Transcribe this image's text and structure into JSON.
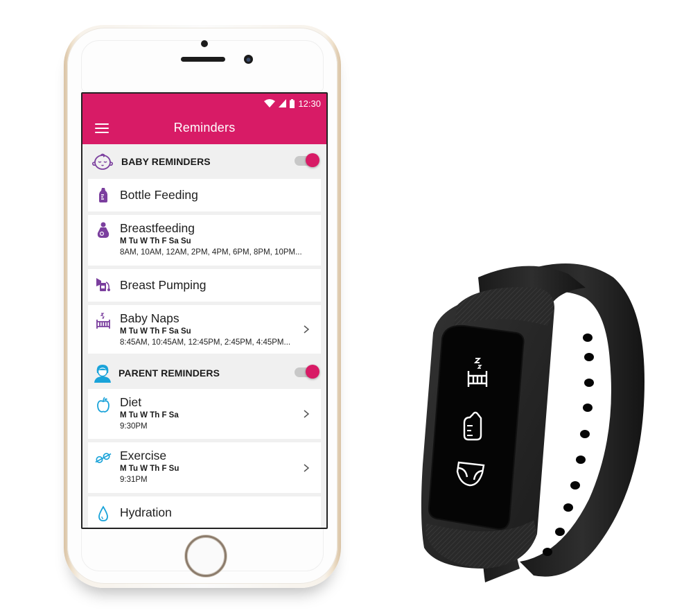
{
  "status_bar": {
    "icons": [
      "wifi-icon",
      "cell-signal-icon",
      "battery-icon"
    ],
    "time": "12:30"
  },
  "app_bar": {
    "menu_icon": "hamburger-menu-icon",
    "title": "Reminders"
  },
  "colors": {
    "accent": "#d81b66",
    "baby_icon": "#7b3f9e",
    "parent_icon": "#1aa3d9",
    "background": "#f0f0f0"
  },
  "sections": [
    {
      "title": "BABY REMINDERS",
      "icon": "baby-face-icon",
      "toggle_on": true,
      "items": [
        {
          "title": "Bottle Feeding",
          "icon": "baby-bottle-icon",
          "days": "",
          "times": "",
          "has_chevron": false
        },
        {
          "title": "Breastfeeding",
          "icon": "breastfeeding-icon",
          "days": "M Tu W Th F Sa Su",
          "times": "8AM, 10AM, 12AM, 2PM, 4PM, 6PM, 8PM, 10PM...",
          "has_chevron": false
        },
        {
          "title": "Breast Pumping",
          "icon": "breast-pump-icon",
          "days": "",
          "times": "",
          "has_chevron": false
        },
        {
          "title": "Baby Naps",
          "icon": "crib-sleep-icon",
          "days": "M Tu W Th F Sa Su",
          "times": "8:45AM, 10:45AM, 12:45PM, 2:45PM, 4:45PM...",
          "has_chevron": true
        }
      ]
    },
    {
      "title": "PARENT REMINDERS",
      "icon": "parent-avatar-icon",
      "toggle_on": true,
      "items": [
        {
          "title": "Diet",
          "icon": "apple-icon",
          "days": "M Tu W Th F Sa",
          "times": "9:30PM",
          "has_chevron": true
        },
        {
          "title": "Exercise",
          "icon": "dumbbell-icon",
          "days": "M Tu W Th F Su",
          "times": "9:31PM",
          "has_chevron": true
        },
        {
          "title": "Hydration",
          "icon": "water-drop-icon",
          "days": "",
          "times": "",
          "has_chevron": false
        }
      ]
    }
  ],
  "band_display": {
    "icons": [
      "crib-sleep-icon",
      "baby-bottle-icon",
      "diaper-icon"
    ]
  }
}
